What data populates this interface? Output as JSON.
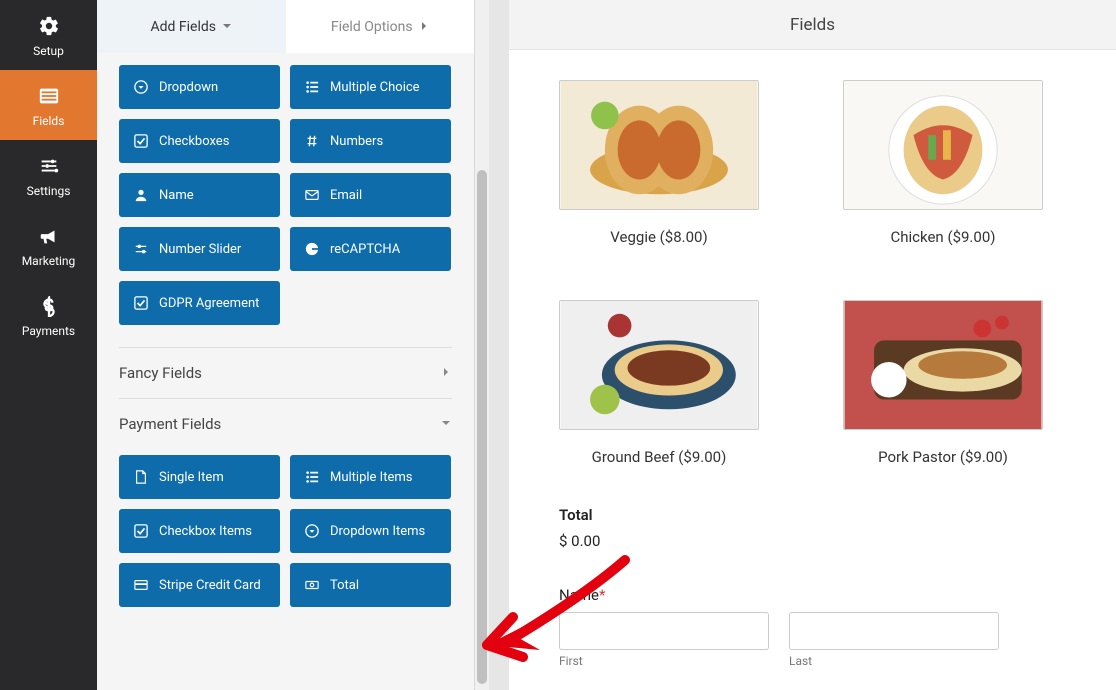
{
  "nav": {
    "items": [
      {
        "id": "setup",
        "label": "Setup"
      },
      {
        "id": "fields",
        "label": "Fields"
      },
      {
        "id": "settings",
        "label": "Settings"
      },
      {
        "id": "marketing",
        "label": "Marketing"
      },
      {
        "id": "payments",
        "label": "Payments"
      }
    ],
    "active": 1
  },
  "panel": {
    "tabs": {
      "add": "Add Fields",
      "options": "Field Options"
    },
    "standard": [
      {
        "id": "dropdown",
        "label": "Dropdown",
        "icon": "chevron"
      },
      {
        "id": "multiple-choice",
        "label": "Multiple Choice",
        "icon": "list"
      },
      {
        "id": "checkboxes",
        "label": "Checkboxes",
        "icon": "check"
      },
      {
        "id": "numbers",
        "label": "Numbers",
        "icon": "hash"
      },
      {
        "id": "name",
        "label": "Name",
        "icon": "user"
      },
      {
        "id": "email",
        "label": "Email",
        "icon": "mail"
      },
      {
        "id": "number-slider",
        "label": "Number Slider",
        "icon": "sliders"
      },
      {
        "id": "recaptcha",
        "label": "reCAPTCHA",
        "icon": "google"
      },
      {
        "id": "gdpr",
        "label": "GDPR Agreement",
        "icon": "check"
      }
    ],
    "sections": {
      "fancy": "Fancy Fields",
      "payment": "Payment Fields"
    },
    "payment": [
      {
        "id": "single-item",
        "label": "Single Item",
        "icon": "file"
      },
      {
        "id": "multiple-items",
        "label": "Multiple Items",
        "icon": "list"
      },
      {
        "id": "checkbox-items",
        "label": "Checkbox Items",
        "icon": "check"
      },
      {
        "id": "dropdown-items",
        "label": "Dropdown Items",
        "icon": "chevron"
      },
      {
        "id": "stripe",
        "label": "Stripe Credit Card",
        "icon": "card"
      },
      {
        "id": "total",
        "label": "Total",
        "icon": "money"
      }
    ]
  },
  "preview": {
    "header": "Fields",
    "products": [
      {
        "label": "Veggie ($8.00)"
      },
      {
        "label": "Chicken ($9.00)"
      },
      {
        "label": "Ground Beef ($9.00)"
      },
      {
        "label": "Pork Pastor ($9.00)"
      }
    ],
    "total": {
      "label": "Total",
      "value": "$ 0.00"
    },
    "name": {
      "label": "Name",
      "required": "*",
      "first": "First",
      "last": "Last"
    }
  }
}
